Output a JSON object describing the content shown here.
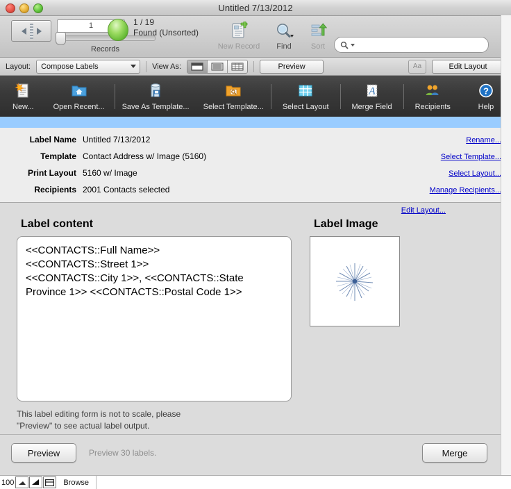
{
  "window": {
    "title": "Untitled 7/13/2012"
  },
  "toolbar": {
    "record_number": "1",
    "found_count": "1 / 19",
    "found_status": "Found (Unsorted)",
    "records_label": "Records",
    "new_record_label": "New Record",
    "find_label": "Find",
    "sort_label": "Sort",
    "search_placeholder": "",
    "overflow_label": "»"
  },
  "layout_bar": {
    "layout_label": "Layout:",
    "layout_value": "Compose Labels",
    "view_as_label": "View As:",
    "view_modes": [
      "form-view",
      "list-view",
      "table-view"
    ],
    "active_view": "form-view",
    "preview_label": "Preview",
    "font_label": "Aa",
    "edit_layout_label": "Edit Layout"
  },
  "dark_toolbar": {
    "items": [
      {
        "label": "New...",
        "icon": "new-document-icon"
      },
      {
        "label": "Open Recent...",
        "icon": "open-folder-icon"
      },
      {
        "label": "Save As Template...",
        "icon": "save-template-icon"
      },
      {
        "label": "Select Template...",
        "icon": "select-template-icon"
      },
      {
        "label": "Select Layout",
        "icon": "grid-layout-icon"
      },
      {
        "label": "Merge Field",
        "icon": "merge-field-icon"
      },
      {
        "label": "Recipients",
        "icon": "recipients-icon"
      },
      {
        "label": "Help",
        "icon": "help-icon"
      }
    ]
  },
  "info": {
    "rows": [
      {
        "label": "Label Name",
        "value": "Untitled 7/13/2012",
        "link": "Rename..."
      },
      {
        "label": "Template",
        "value": "Contact Address w/ Image (5160)",
        "link": "Select Template..."
      },
      {
        "label": "Print Layout",
        "value": "5160 w/ Image",
        "link": "Select Layout..."
      },
      {
        "label": "Recipients",
        "value": "2001 Contacts selected",
        "link": "Manage Recipients..."
      }
    ]
  },
  "body": {
    "edit_layout_link": "Edit Layout...",
    "label_content_heading": "Label content",
    "label_content_text": "<<CONTACTS::Full Name>>\n<<CONTACTS::Street 1>>\n<<CONTACTS::City 1>>, <<CONTACTS::State Province 1>> <<CONTACTS::Postal Code 1>>",
    "label_image_heading": "Label Image",
    "image_alt": "starburst-thumbnail",
    "note": "This label editing form is not to scale, please\n\"Preview\" to see actual label output."
  },
  "footer": {
    "preview_button": "Preview",
    "preview_note": "Preview 30 labels.",
    "merge_button": "Merge"
  },
  "status_bar": {
    "zoom_level": "100",
    "zoom_out_icon": "zoom-out-icon",
    "zoom_in_icon": "zoom-in-icon",
    "toggle_icon": "toggle-statusarea-icon",
    "mode": "Browse"
  },
  "colors": {
    "blue_strip": "#99CCFF",
    "link": "#0000C8",
    "dark_toolbar": "#3a3a3a",
    "panel": "#EDEDED",
    "content": "#DCDCDC"
  }
}
